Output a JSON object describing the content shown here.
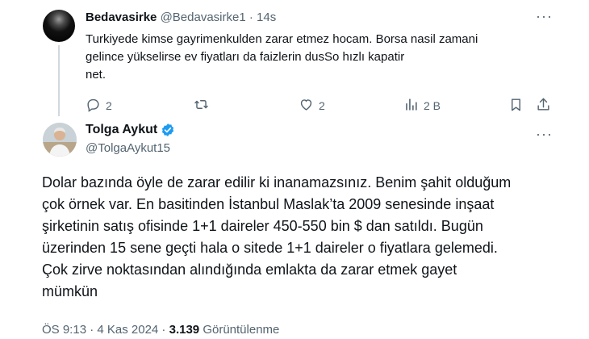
{
  "reply": {
    "author_name": "Bedavasirke",
    "handle": "@Bedavasirke1",
    "separator": " · ",
    "time": "14s",
    "text": "Turkiyede kimse gayrimenkulden zarar etmez hocam. Borsa nasil zamani gelince yükselirse ev fiyatları da faizlerin dusSo hızlı kapatir net.",
    "text_lines": [
      "Turkiyede kimse gayrimenkulden zarar etmez hocam. Borsa nasil zamani",
      "gelince yükselirse ev fiyatları da faizlerin dusSo hızlı kapatir",
      "net."
    ],
    "more_label": "···",
    "actions": {
      "reply_count": "2",
      "repost_count": "",
      "like_count": "2",
      "views_count": "2 B"
    }
  },
  "main": {
    "author_name": "Tolga Aykut",
    "handle": "@TolgaAykut15",
    "more_label": "···",
    "text_lines": [
      "Dolar bazında öyle de zarar edilir ki inanamazsınız. Benim şahit olduğum",
      "çok örnek var. En basitinden İstanbul Maslak’ta 2009 senesinde inşaat",
      "şirketinin satış ofisinde 1+1 daireler 450-550 bin $ dan satıldı. Bugün",
      "üzerinden 15 sene geçti hala o sitede 1+1 daireler o fiyatlara gelemedi.",
      "Çok zirve noktasından alındığında emlakta da zarar etmek gayet",
      "mümkün"
    ],
    "timestamp": "ÖS 9:13 · 4 Kas 2024",
    "dot": " · ",
    "views": "3.139",
    "views_label": " Görüntülenme"
  },
  "icons": {
    "reply": "reply-icon",
    "repost": "repost-icon",
    "like": "heart-icon",
    "views": "views-bar-icon",
    "bookmark": "bookmark-icon",
    "share": "share-icon",
    "verified": "verified-badge-icon"
  },
  "colors": {
    "text": "#0f1419",
    "muted": "#536471",
    "verified": "#1d9bf0",
    "thread_line": "#cfd9de"
  }
}
